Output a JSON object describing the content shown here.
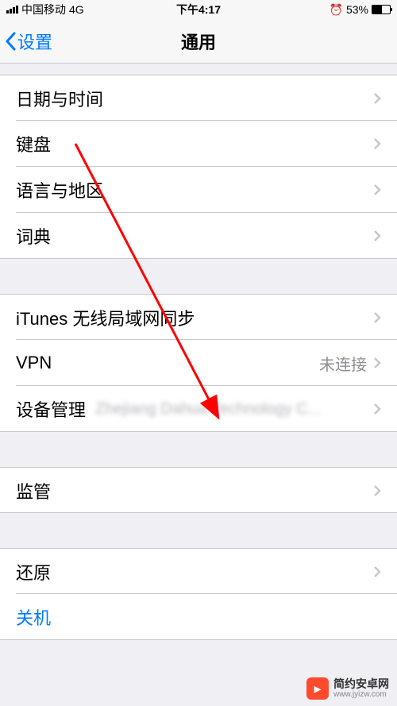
{
  "status_bar": {
    "carrier": "中国移动",
    "network": "4G",
    "time": "下午4:17",
    "alarm_icon": "⏰",
    "battery_percent": "53%"
  },
  "nav": {
    "back_label": "设置",
    "title": "通用"
  },
  "groups": [
    {
      "rows": [
        {
          "label": "日期与时间",
          "detail": "",
          "has_chevron": true
        },
        {
          "label": "键盘",
          "detail": "",
          "has_chevron": true
        },
        {
          "label": "语言与地区",
          "detail": "",
          "has_chevron": true
        },
        {
          "label": "词典",
          "detail": "",
          "has_chevron": true
        }
      ]
    },
    {
      "rows": [
        {
          "label": "iTunes 无线局域网同步",
          "detail": "",
          "has_chevron": true
        },
        {
          "label": "VPN",
          "detail": "未连接",
          "has_chevron": true
        },
        {
          "label": "设备管理",
          "detail": "Zhejiang Dahua Technology C...",
          "detail_blurred": true,
          "has_chevron": true
        }
      ]
    },
    {
      "rows": [
        {
          "label": "监管",
          "detail": "",
          "has_chevron": true
        }
      ]
    },
    {
      "rows": [
        {
          "label": "还原",
          "detail": "",
          "has_chevron": true
        },
        {
          "label": "关机",
          "detail": "",
          "has_chevron": false,
          "is_link": true
        }
      ]
    }
  ],
  "watermark": {
    "title": "简约安卓网",
    "url": "www.jyizw.com"
  }
}
